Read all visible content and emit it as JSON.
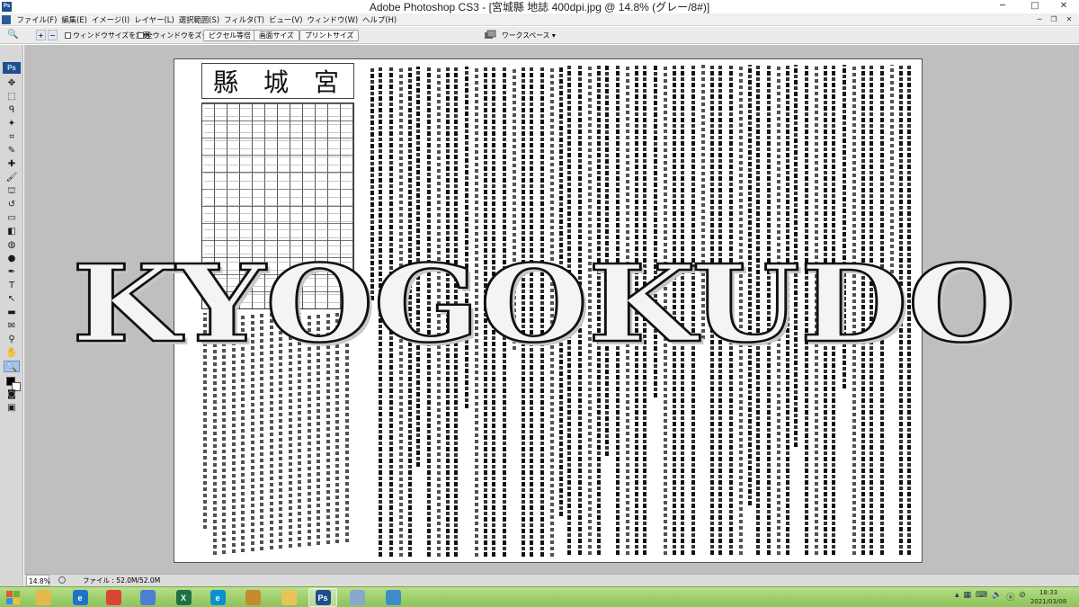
{
  "window": {
    "title": "Adobe Photoshop CS3 - [宮城縣 地誌 400dpi.jpg @ 14.8% (グレー/8#)]",
    "app_icon_label": "Ps",
    "minimize_glyph": "─",
    "maximize_glyph": "□",
    "close_glyph": "✕"
  },
  "menubar": {
    "items": [
      "ファイル(F)",
      "編集(E)",
      "イメージ(I)",
      "レイヤー(L)",
      "選択範囲(S)",
      "フィルタ(T)",
      "ビュー(V)",
      "ウィンドウ(W)",
      "ヘルプ(H)"
    ],
    "doc_minimize_glyph": "─",
    "doc_restore_glyph": "❐",
    "doc_close_glyph": "✕"
  },
  "optionsbar": {
    "tool_glyph": "🔍",
    "zoom_in_glyph": "+",
    "zoom_out_glyph": "−",
    "resize_windows_label": "ウィンドウサイズを変更",
    "zoom_all_label": "全ウィンドウをズーム",
    "actual_pixels_label": "ピクセル等倍",
    "fit_screen_label": "画面サイズ",
    "print_size_label": "プリントサイズ",
    "workspace_label": "ワークスペース ▾"
  },
  "toolbox": {
    "logo": "Ps",
    "tools": [
      {
        "name": "move-tool",
        "glyph": "✥"
      },
      {
        "name": "marquee-tool",
        "glyph": "⬚"
      },
      {
        "name": "lasso-tool",
        "glyph": "ᑫ"
      },
      {
        "name": "magic-wand-tool",
        "glyph": "✦"
      },
      {
        "name": "crop-tool",
        "glyph": "⌗"
      },
      {
        "name": "slice-tool",
        "glyph": "✎"
      },
      {
        "name": "healing-brush-tool",
        "glyph": "✚"
      },
      {
        "name": "brush-tool",
        "glyph": "🖌"
      },
      {
        "name": "clone-stamp-tool",
        "glyph": "⛫"
      },
      {
        "name": "history-brush-tool",
        "glyph": "↺"
      },
      {
        "name": "eraser-tool",
        "glyph": "▭"
      },
      {
        "name": "gradient-tool",
        "glyph": "◧"
      },
      {
        "name": "blur-tool",
        "glyph": "◍"
      },
      {
        "name": "dodge-tool",
        "glyph": "●"
      },
      {
        "name": "pen-tool",
        "glyph": "✒"
      },
      {
        "name": "type-tool",
        "glyph": "T"
      },
      {
        "name": "path-selection-tool",
        "glyph": "↖"
      },
      {
        "name": "shape-tool",
        "glyph": "▬"
      },
      {
        "name": "notes-tool",
        "glyph": "✉"
      },
      {
        "name": "eyedropper-tool",
        "glyph": "⚲"
      },
      {
        "name": "hand-tool",
        "glyph": "✋"
      },
      {
        "name": "zoom-tool",
        "glyph": "🔍"
      }
    ],
    "quickmask_glyph": "◙",
    "screenmode_glyph": "▣"
  },
  "document": {
    "masthead_chars": [
      "縣",
      "城",
      "宮"
    ],
    "watermark_text": "KYOGOKUDO"
  },
  "statusbar": {
    "zoom": "14.8%",
    "file_info": "ファイル : 52.0M/52.0M"
  },
  "taskbar": {
    "apps": [
      {
        "name": "explorer",
        "label": "",
        "color": "#e6b84a"
      },
      {
        "name": "edge-legacy",
        "label": "e",
        "color": "#1e73c8"
      },
      {
        "name": "chrome",
        "label": "",
        "color": "#db4437"
      },
      {
        "name": "mail",
        "label": "",
        "color": "#4a7fd1"
      },
      {
        "name": "excel",
        "label": "X",
        "color": "#1e7145"
      },
      {
        "name": "edge",
        "label": "e",
        "color": "#0c8fd0"
      },
      {
        "name": "volume",
        "label": "",
        "color": "#c58a2f"
      },
      {
        "name": "folder",
        "label": "",
        "color": "#e8c35a"
      },
      {
        "name": "photoshop",
        "label": "Ps",
        "color": "#1f4e8c"
      },
      {
        "name": "paint",
        "label": "",
        "color": "#8aa7d0"
      },
      {
        "name": "viewer",
        "label": "",
        "color": "#3f8bc6"
      }
    ],
    "time": "18:33",
    "date": "2021/03/08"
  }
}
